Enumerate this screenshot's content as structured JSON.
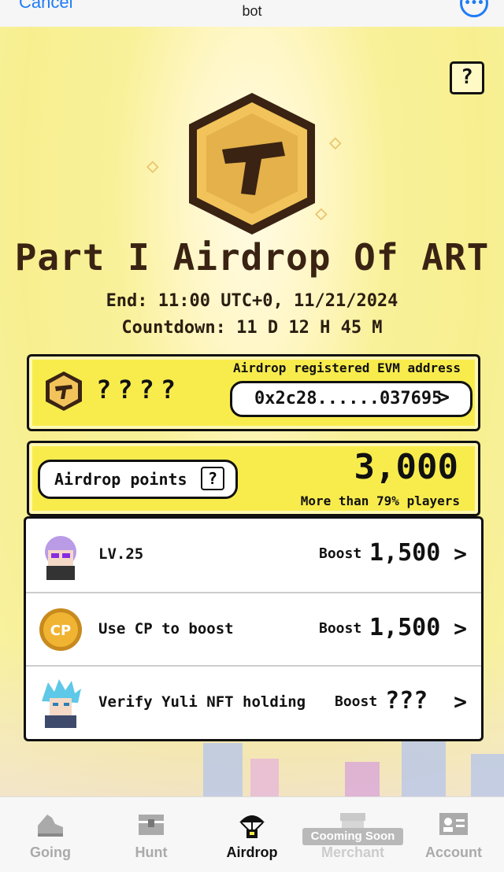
{
  "topbar": {
    "cancel_label": "Cancel",
    "title": "bot"
  },
  "hero": {
    "title": "Part I Airdrop Of ART",
    "end": "End: 11:00 UTC+0, 11/21/2024",
    "countdown": "Countdown: 11 D 12 H 45 M"
  },
  "evm_card": {
    "amount": "????",
    "label": "Airdrop registered EVM address",
    "address": "0x2c28......037695",
    "chevron": ">"
  },
  "points_card": {
    "label": "Airdrop points",
    "help": "?",
    "value": "3,000",
    "rank": "More than 79% players"
  },
  "boost_rows": [
    {
      "label": "LV.25",
      "boost_label": "Boost",
      "amount": "1,500",
      "icon": "character-avatar"
    },
    {
      "label": "Use CP to boost",
      "boost_label": "Boost",
      "amount": "1,500",
      "icon": "cp-coin-icon"
    },
    {
      "label": "Verify Yuli NFT holding",
      "boost_label": "Boost",
      "amount": "???",
      "icon": "yuli-nft-avatar"
    }
  ],
  "tabs": [
    {
      "label": "Going",
      "icon": "sneaker-icon",
      "active": false
    },
    {
      "label": "Hunt",
      "icon": "chest-icon",
      "active": false
    },
    {
      "label": "Airdrop",
      "icon": "parachute-icon",
      "active": true
    },
    {
      "label": "Merchant",
      "icon": "shop-icon",
      "active": false,
      "badge": "Cooming Soon"
    },
    {
      "label": "Account",
      "icon": "id-card-icon",
      "active": false
    }
  ],
  "colors": {
    "accent_yellow": "#f8ec4d",
    "ink": "#111111",
    "link_blue": "#1f7cf5"
  }
}
